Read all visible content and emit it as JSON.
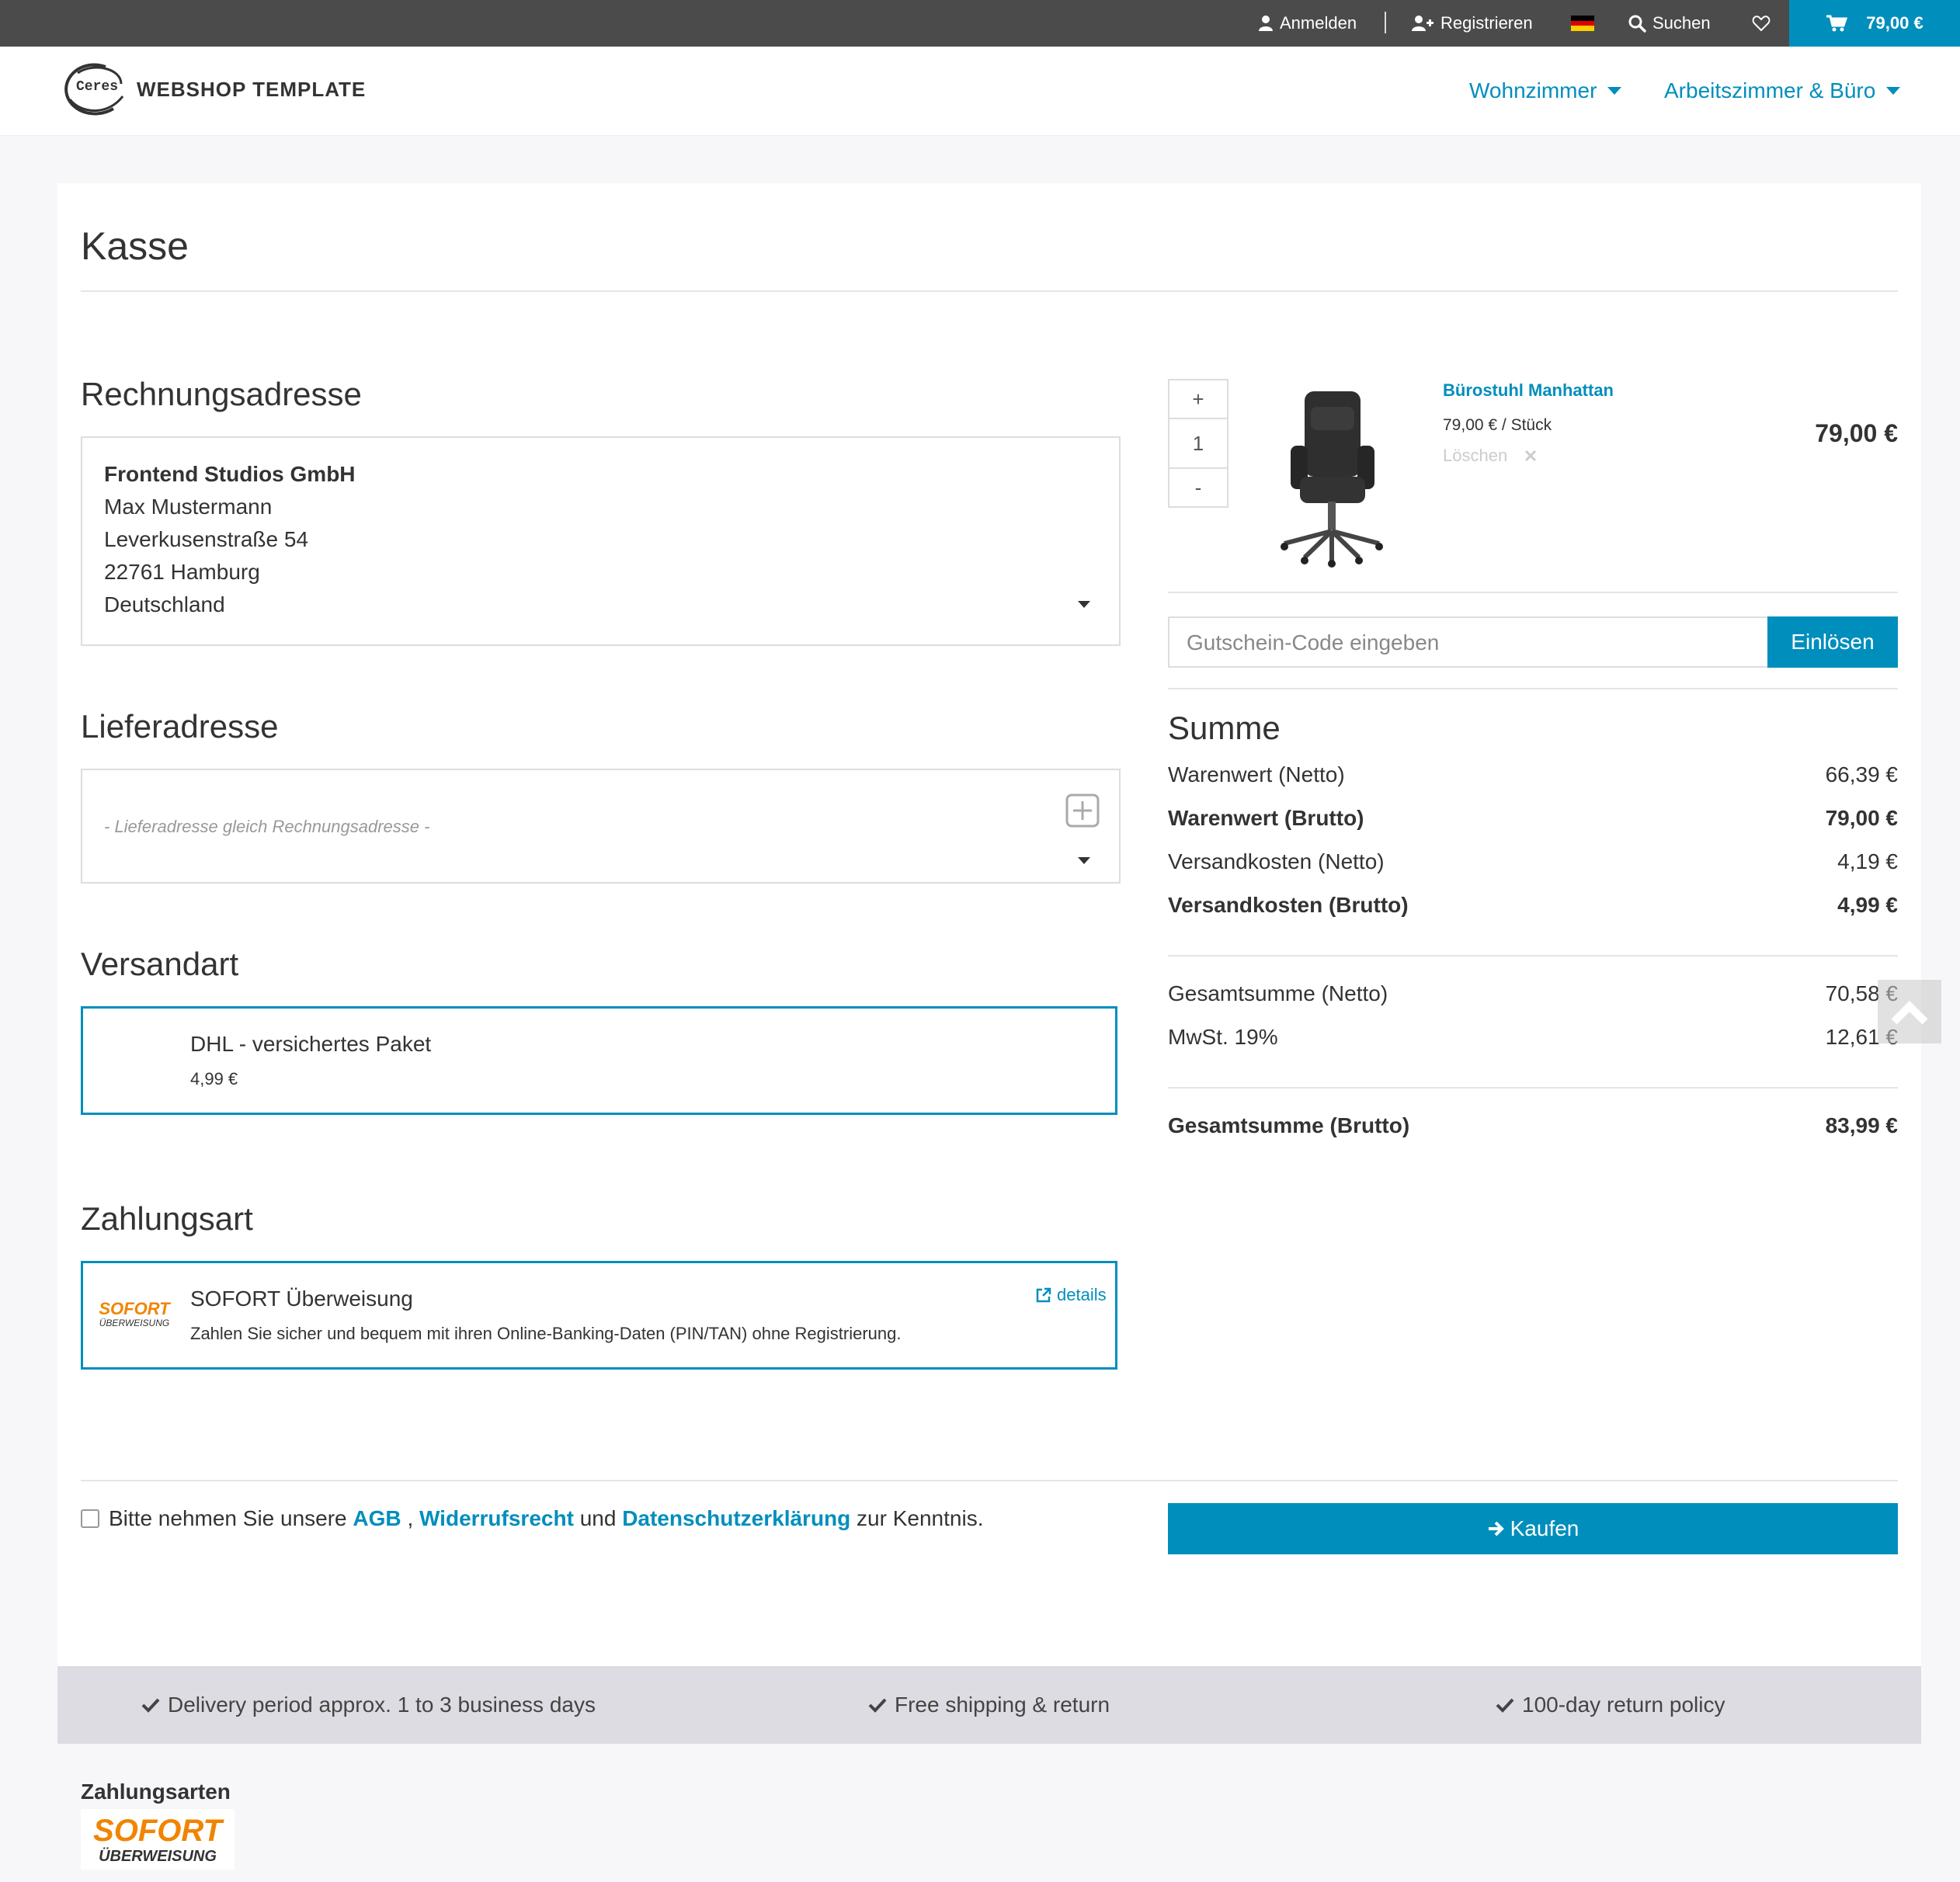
{
  "topbar": {
    "login": "Anmelden",
    "register": "Registrieren",
    "search": "Suchen",
    "cart_total": "79,00 €"
  },
  "header": {
    "logo_mark": "Ceres",
    "logo_text": "WEBSHOP TEMPLATE",
    "nav": [
      "Wohnzimmer",
      "Arbeitszimmer & Büro"
    ]
  },
  "page": {
    "title": "Kasse"
  },
  "billing": {
    "heading": "Rechnungsadresse",
    "company": "Frontend Studios GmbH",
    "name": "Max Mustermann",
    "street": "Leverkusenstraße 54",
    "city": "22761 Hamburg",
    "country": "Deutschland"
  },
  "shipping_address": {
    "heading": "Lieferadresse",
    "placeholder": "- Lieferadresse gleich Rechnungsadresse -"
  },
  "shipping_method": {
    "heading": "Versandart",
    "name": "DHL - versichertes Paket",
    "price": "4,99 €"
  },
  "payment": {
    "heading": "Zahlungsart",
    "logo_top": "SOFORT",
    "logo_bottom": "ÜBERWEISUNG",
    "name": "SOFORT Überweisung",
    "description": "Zahlen Sie sicher und bequem mit ihren Online-Banking-Daten (PIN/TAN) ohne Registrierung.",
    "details_link": "details"
  },
  "cart_item": {
    "qty_plus": "+",
    "quantity": "1",
    "qty_minus": "-",
    "name": "Bürostuhl Manhattan",
    "unit_price": "79,00 € / Stück",
    "delete": "Löschen",
    "total": "79,00 €"
  },
  "coupon": {
    "placeholder": "Gutschein-Code eingeben",
    "button": "Einlösen"
  },
  "summary": {
    "heading": "Summe",
    "rows": [
      {
        "label": "Warenwert (Netto)",
        "value": "66,39 €"
      },
      {
        "label": "Warenwert (Brutto)",
        "value": "79,00 €"
      },
      {
        "label": "Versandkosten (Netto)",
        "value": "4,19 €"
      },
      {
        "label": "Versandkosten (Brutto)",
        "value": "4,99 €"
      },
      {
        "label": "Gesamtsumme (Netto)",
        "value": "70,58 €"
      },
      {
        "label": "MwSt. 19%",
        "value": "12,61 €"
      },
      {
        "label": "Gesamtsumme (Brutto)",
        "value": "83,99 €"
      }
    ]
  },
  "terms": {
    "prefix": "Bitte nehmen Sie unsere",
    "agb": "AGB",
    "comma": ",",
    "withdrawal": "Widerrufsrecht",
    "and": "und",
    "privacy": "Datenschutzerklärung",
    "suffix": "zur Kenntnis."
  },
  "buy_button": "Kaufen",
  "features": [
    "Delivery period approx. 1 to 3 business days",
    "Free shipping & return",
    "100-day return policy"
  ],
  "footer": {
    "payment_methods_heading": "Zahlungsarten",
    "logo_top": "SOFORT",
    "logo_bottom": "ÜBERWEISUNG"
  },
  "colors": {
    "accent": "#008ebd",
    "topbar": "#4a4b4a"
  }
}
